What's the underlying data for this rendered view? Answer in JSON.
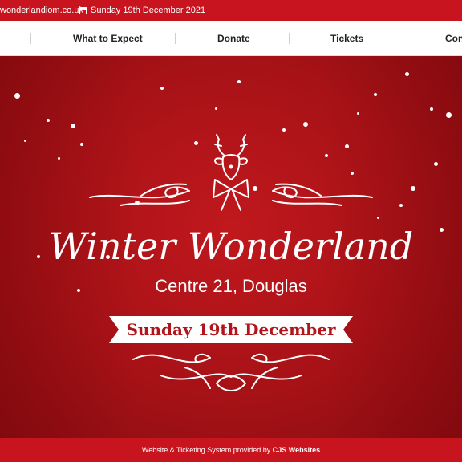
{
  "topbar": {
    "email": "wonderlandiom.co.uk",
    "date": "Sunday 19th December 2021"
  },
  "nav": {
    "items": [
      "What to Expect",
      "Donate",
      "Tickets",
      "Con"
    ]
  },
  "hero": {
    "title": "Winter Wonderland",
    "subtitle": "Centre 21, Douglas",
    "ribbon": "Sunday 19th December"
  },
  "footer": {
    "text": "Website & Ticketing System provided by",
    "brand": "CJS Websites"
  },
  "colors": {
    "brand_red": "#c8141f",
    "hero_red": "#b3151a",
    "white": "#ffffff"
  }
}
